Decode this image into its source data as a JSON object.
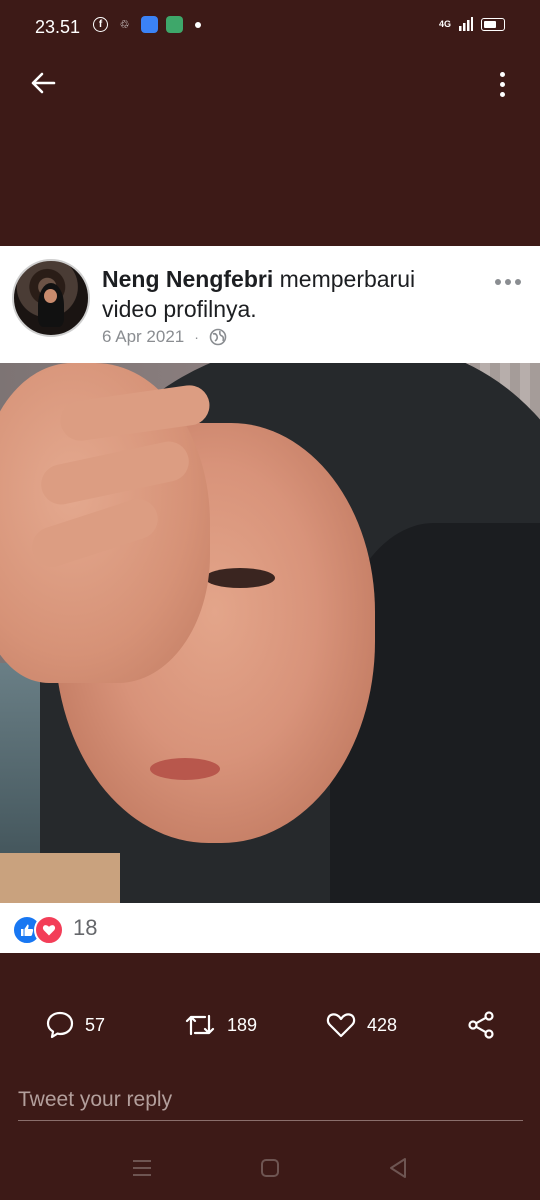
{
  "status_bar": {
    "time": "23.51",
    "network": "4G",
    "battery_level": 0.8,
    "notification_icons": [
      "facebook-icon",
      "recycle-icon",
      "app-blue-icon",
      "app-green-icon"
    ]
  },
  "toolbar": {
    "back_icon": "arrow-left-icon",
    "menu_icon": "more-vertical-icon"
  },
  "post": {
    "author": "Neng Nengfebri",
    "action_text": " memperbarui video profilnya.",
    "date": "6 Apr 2021",
    "separator": "·",
    "privacy_icon": "globe-icon",
    "options_icon": "more-horizontal-icon"
  },
  "reactions": {
    "types": [
      "like",
      "love"
    ],
    "count": "18"
  },
  "tweet_actions": {
    "replies": "57",
    "retweets": "189",
    "likes": "428"
  },
  "reply": {
    "placeholder": "Tweet your reply"
  },
  "nav": {
    "buttons": [
      "menu-lines-icon",
      "home-square-icon",
      "back-triangle-icon"
    ]
  },
  "colors": {
    "background": "#3d1a17",
    "card": "#ffffff",
    "like_blue": "#1877f2",
    "love_red": "#f33e58"
  }
}
